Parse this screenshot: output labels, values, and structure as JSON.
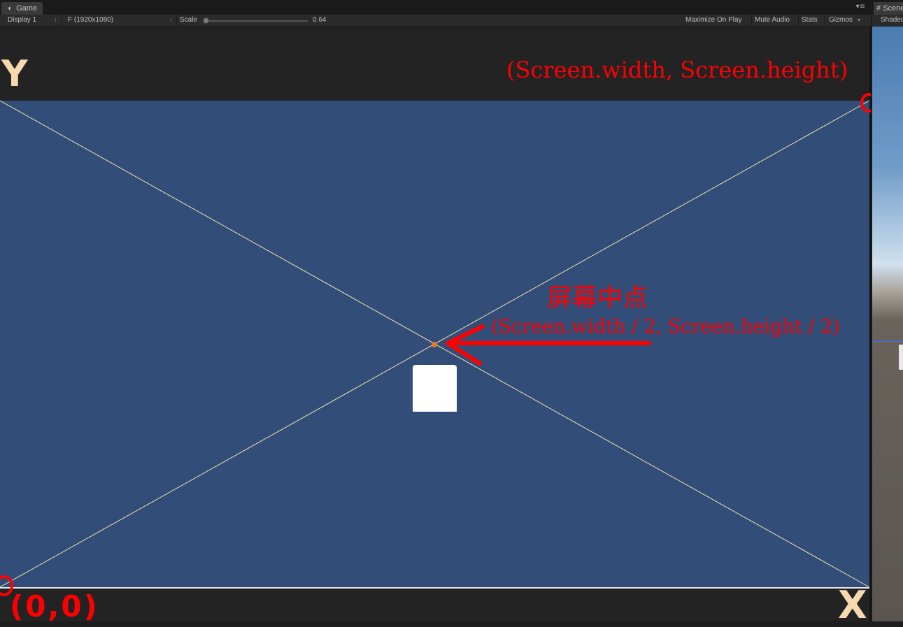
{
  "game_tab": {
    "label": "Game",
    "icon": "pacman-icon"
  },
  "toolbar": {
    "display": "Display 1",
    "resolution": "F (1920x1080)",
    "scale_label": "Scale",
    "scale_value": "0.64",
    "maximize": "Maximize On Play",
    "mute": "Mute Audio",
    "stats": "Stats",
    "gizmos": "Gizmos"
  },
  "annotations": {
    "top_right": "(Screen.width, Screen.height)",
    "center_title": "屏幕中点",
    "center_coords": "(Screen.width / 2, Screen.height / 2)",
    "origin": "(0,0)",
    "axis_x": "X",
    "axis_y": "Y",
    "color": "#ff0000"
  },
  "scene_tab": {
    "label": "Scene",
    "shading": "Shaded"
  },
  "colors": {
    "viewport": "#314d78",
    "diagonal": "#f3e2b8",
    "axis_letters": "#f7d9b0"
  }
}
